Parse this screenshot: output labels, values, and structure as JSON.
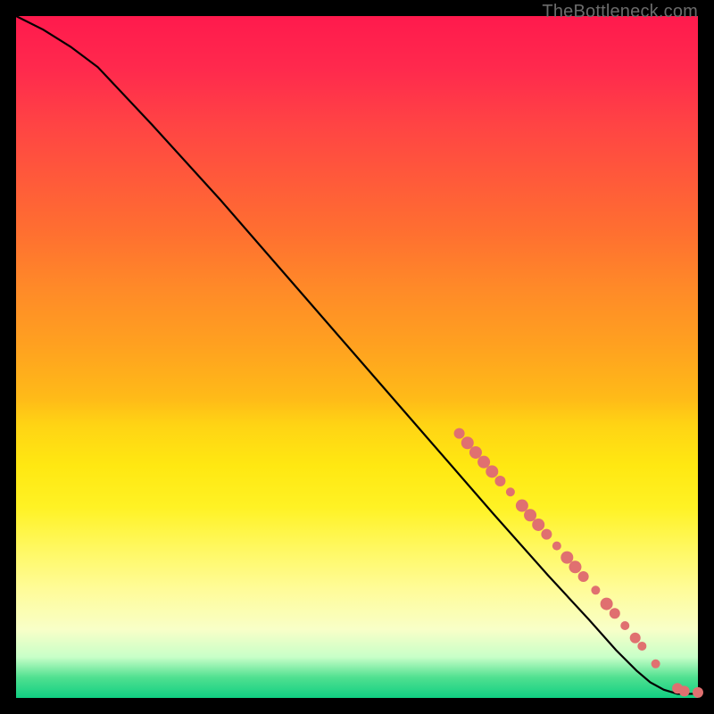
{
  "watermark": "TheBottleneck.com",
  "chart_data": {
    "type": "line",
    "title": "",
    "xlabel": "",
    "ylabel": "",
    "xlim": [
      0,
      100
    ],
    "ylim": [
      0,
      100
    ],
    "series": [
      {
        "name": "curve",
        "x": [
          0,
          4,
          8,
          12,
          20,
          30,
          40,
          50,
          60,
          70,
          78,
          84,
          88,
          91,
          93,
          95,
          97,
          100
        ],
        "y": [
          100,
          98,
          95.5,
          92.5,
          84,
          73,
          61.5,
          50,
          38.5,
          27,
          18,
          11.5,
          7,
          4,
          2.3,
          1.2,
          0.6,
          0.6
        ]
      }
    ],
    "markers": [
      {
        "x": 65.0,
        "y": 38.8,
        "r": 6
      },
      {
        "x": 66.2,
        "y": 37.4,
        "r": 7
      },
      {
        "x": 67.4,
        "y": 36.0,
        "r": 7
      },
      {
        "x": 68.6,
        "y": 34.6,
        "r": 7
      },
      {
        "x": 69.8,
        "y": 33.2,
        "r": 7
      },
      {
        "x": 71.0,
        "y": 31.8,
        "r": 6
      },
      {
        "x": 72.5,
        "y": 30.2,
        "r": 5
      },
      {
        "x": 74.2,
        "y": 28.2,
        "r": 7
      },
      {
        "x": 75.4,
        "y": 26.8,
        "r": 7
      },
      {
        "x": 76.6,
        "y": 25.4,
        "r": 7
      },
      {
        "x": 77.8,
        "y": 24.0,
        "r": 6
      },
      {
        "x": 79.3,
        "y": 22.3,
        "r": 5
      },
      {
        "x": 80.8,
        "y": 20.6,
        "r": 7
      },
      {
        "x": 82.0,
        "y": 19.2,
        "r": 7
      },
      {
        "x": 83.2,
        "y": 17.8,
        "r": 6
      },
      {
        "x": 85.0,
        "y": 15.8,
        "r": 5
      },
      {
        "x": 86.6,
        "y": 13.8,
        "r": 7
      },
      {
        "x": 87.8,
        "y": 12.4,
        "r": 6
      },
      {
        "x": 89.3,
        "y": 10.6,
        "r": 5
      },
      {
        "x": 90.8,
        "y": 8.8,
        "r": 6
      },
      {
        "x": 91.8,
        "y": 7.6,
        "r": 5
      },
      {
        "x": 93.8,
        "y": 5.0,
        "r": 5
      },
      {
        "x": 97.0,
        "y": 1.4,
        "r": 6
      },
      {
        "x": 98.0,
        "y": 1.0,
        "r": 6
      },
      {
        "x": 100.0,
        "y": 0.8,
        "r": 6
      }
    ],
    "marker_color": "#e07070",
    "line_color": "#000000"
  }
}
